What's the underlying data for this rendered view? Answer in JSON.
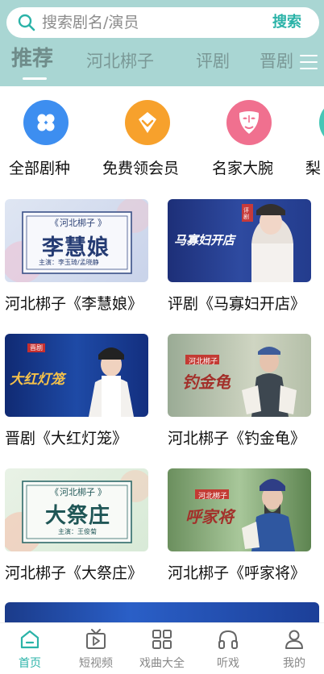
{
  "search": {
    "placeholder": "搜索剧名/演员",
    "button_label": "搜索"
  },
  "tabs": [
    {
      "label": "推荐",
      "active": true
    },
    {
      "label": "河北梆子",
      "active": false
    },
    {
      "label": "评剧",
      "active": false
    },
    {
      "label": "晋剧",
      "active": false
    }
  ],
  "quick_entries": [
    {
      "label": "全部剧种",
      "icon": "grid-icon",
      "color": "#3d8ef0"
    },
    {
      "label": "免费领会员",
      "icon": "diamond-icon",
      "color": "#f7a12c"
    },
    {
      "label": "名家大腕",
      "icon": "mask-icon",
      "color": "#f0708f"
    },
    {
      "label": "梨",
      "icon": "circle-icon",
      "color": "#46c7b6"
    }
  ],
  "videos": [
    {
      "title": "河北梆子《李慧娘》",
      "thumb_tag": "河北梆子",
      "thumb_title": "李慧娘",
      "thumb_cast": "主演：李玉琦/孟晓静"
    },
    {
      "title": "评剧《马寡妇开店》",
      "thumb_tag": "评剧",
      "thumb_title": "马寡妇开店"
    },
    {
      "title": "晋剧《大红灯笼》",
      "thumb_tag": "晋剧",
      "thumb_title": "大红灯笼"
    },
    {
      "title": "河北梆子《钓金龟》",
      "thumb_tag": "河北梆子",
      "thumb_title": "钓金龟"
    },
    {
      "title": "河北梆子《大祭庄》",
      "thumb_tag": "河北梆子",
      "thumb_title": "大祭庄",
      "thumb_cast": "主演：王俊菊"
    },
    {
      "title": "河北梆子《呼家将》",
      "thumb_tag": "河北梆子",
      "thumb_title": "呼家将"
    }
  ],
  "bottom_nav": [
    {
      "label": "首页",
      "icon": "home-icon",
      "active": true
    },
    {
      "label": "短视频",
      "icon": "tv-play-icon",
      "active": false
    },
    {
      "label": "戏曲大全",
      "icon": "grid-squares-icon",
      "active": false
    },
    {
      "label": "听戏",
      "icon": "headphones-icon",
      "active": false
    },
    {
      "label": "我的",
      "icon": "person-icon",
      "active": false
    }
  ],
  "colors": {
    "header_bg": "#a9d6d3",
    "accent": "#2bb3a8"
  }
}
